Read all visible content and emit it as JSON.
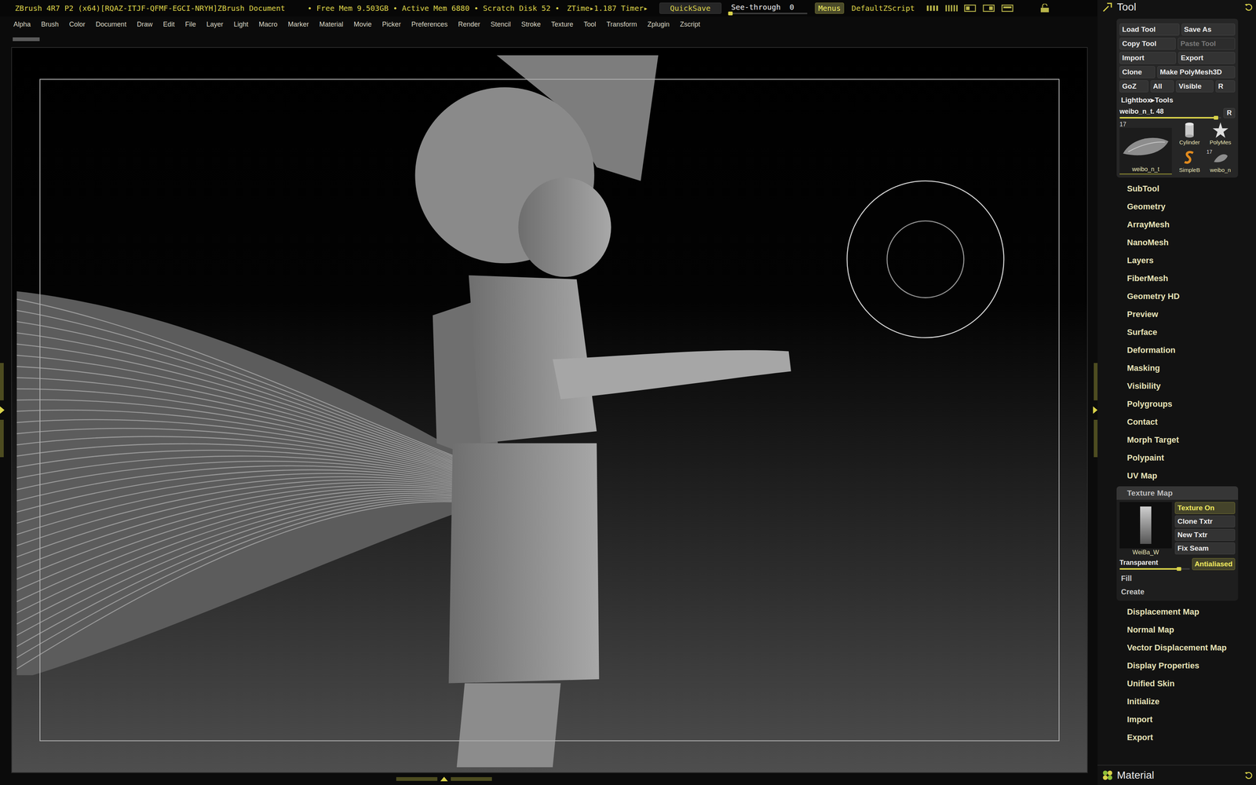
{
  "window": {
    "title": "ZBrush 4R7 P2 (x64)[RQAZ-ITJF-QFMF-EGCI-NRYH]ZBrush Document",
    "status": "• Free Mem 9.503GB • Active Mem 6880 • Scratch Disk 52 •",
    "timer": "ZTime▸1.187 Timer▸"
  },
  "top_controls": {
    "quicksave": "QuickSave",
    "see_through": {
      "label": "See-through",
      "value": "0",
      "level": 0
    },
    "menus": {
      "label": "Menus",
      "on": true
    },
    "script": "DefaultZScript"
  },
  "menu_bar": [
    "Alpha",
    "Brush",
    "Color",
    "Document",
    "Draw",
    "Edit",
    "File",
    "Layer",
    "Light",
    "Macro",
    "Marker",
    "Material",
    "Movie",
    "Picker",
    "Preferences",
    "Render",
    "Stencil",
    "Stroke",
    "Texture",
    "Tool",
    "Transform",
    "Zplugin",
    "Zscript"
  ],
  "tool_panel": {
    "title": "Tool",
    "button_rows": [
      [
        {
          "label": "Load Tool",
          "disabled": false
        },
        {
          "label": "Save As",
          "disabled": false
        }
      ],
      [
        {
          "label": "Copy Tool",
          "disabled": false
        },
        {
          "label": "Paste Tool",
          "disabled": true
        }
      ],
      [
        {
          "label": "Import",
          "disabled": false
        },
        {
          "label": "Export",
          "disabled": false
        }
      ],
      [
        {
          "label": "Clone",
          "disabled": false
        },
        {
          "label": "Make PolyMesh3D",
          "disabled": false
        }
      ],
      [
        {
          "label": "GoZ",
          "disabled": false
        },
        {
          "label": "All",
          "disabled": false
        },
        {
          "label": "Visible",
          "disabled": false
        },
        {
          "label": "R",
          "disabled": false
        }
      ]
    ],
    "lightbox": "Lightbox▸Tools",
    "tool_slider": {
      "label": "weibo_n_t. 48",
      "level": 0.95,
      "reset": "R"
    },
    "current_tool": {
      "count": "17",
      "label": "weibo_n_t"
    },
    "tool_thumbs": [
      {
        "label": "Cylinder"
      },
      {
        "label": "PolyMes"
      },
      {
        "label": "SimpleB"
      },
      {
        "label": "weibo_n",
        "count": "17"
      }
    ],
    "sections": [
      {
        "label": "SubTool",
        "expanded": false
      },
      {
        "label": "Geometry",
        "expanded": false
      },
      {
        "label": "ArrayMesh",
        "expanded": false
      },
      {
        "label": "NanoMesh",
        "expanded": false
      },
      {
        "label": "Layers",
        "expanded": false
      },
      {
        "label": "FiberMesh",
        "expanded": false
      },
      {
        "label": "Geometry HD",
        "expanded": false
      },
      {
        "label": "Preview",
        "expanded": false
      },
      {
        "label": "Surface",
        "expanded": false
      },
      {
        "label": "Deformation",
        "expanded": false
      },
      {
        "label": "Masking",
        "expanded": false
      },
      {
        "label": "Visibility",
        "expanded": false
      },
      {
        "label": "Polygroups",
        "expanded": false
      },
      {
        "label": "Contact",
        "expanded": false
      },
      {
        "label": "Morph Target",
        "expanded": false
      },
      {
        "label": "Polypaint",
        "expanded": false
      },
      {
        "label": "UV Map",
        "expanded": false
      }
    ],
    "texture_map": {
      "label": "Texture Map",
      "expanded": true,
      "thumb_label": "WeiBa_W",
      "buttons": [
        {
          "label": "Texture On",
          "on": true
        },
        {
          "label": "Clone Txtr",
          "on": false
        },
        {
          "label": "New Txtr",
          "on": false
        },
        {
          "label": "Fix Seam",
          "on": false
        }
      ],
      "transparent": {
        "label": "Transparent",
        "level": 0.85
      },
      "antialiased": {
        "label": "Antialiased",
        "on": true
      },
      "actions": [
        "Fill",
        "Create"
      ]
    },
    "sections_after": [
      {
        "label": "Displacement Map",
        "expanded": false
      },
      {
        "label": "Normal Map",
        "expanded": false
      },
      {
        "label": "Vector Displacement Map",
        "expanded": false
      },
      {
        "label": "Display Properties",
        "expanded": false
      },
      {
        "label": "Unified Skin",
        "expanded": false
      },
      {
        "label": "Initialize",
        "expanded": false
      },
      {
        "label": "Import",
        "expanded": false
      },
      {
        "label": "Export",
        "expanded": false
      }
    ]
  },
  "material_panel": {
    "title": "Material"
  }
}
